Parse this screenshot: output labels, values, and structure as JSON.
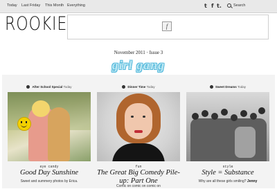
{
  "nav": {
    "items": [
      "Today",
      "Last Friday",
      "This Month",
      "Everything"
    ],
    "social": [
      "t",
      "f",
      "t."
    ],
    "search_label": "Search"
  },
  "logo": "ROOKIE",
  "issue": "November 2011  ·  Issue 3",
  "theme": "girl gang",
  "columns": [
    {
      "category": "After School Special",
      "when": "Today",
      "tag": "eye candy",
      "title": "Good Day Sunshine",
      "desc_prefix": "Sweet and summery photos by Erica.",
      "desc_author": "Erica"
    },
    {
      "category": "Dinner Time",
      "when": "Today",
      "tag": "fun",
      "title": "The Great Big Comedy Pile-up: Part One",
      "desc_prefix": "Comic on comic on comic on",
      "desc_author": ""
    },
    {
      "category": "Sweet Dreams",
      "when": "Today",
      "tag": "style",
      "title": "Style = Substance",
      "desc_prefix": "Why are all these girls smiling?",
      "desc_author": "Jenny"
    }
  ]
}
